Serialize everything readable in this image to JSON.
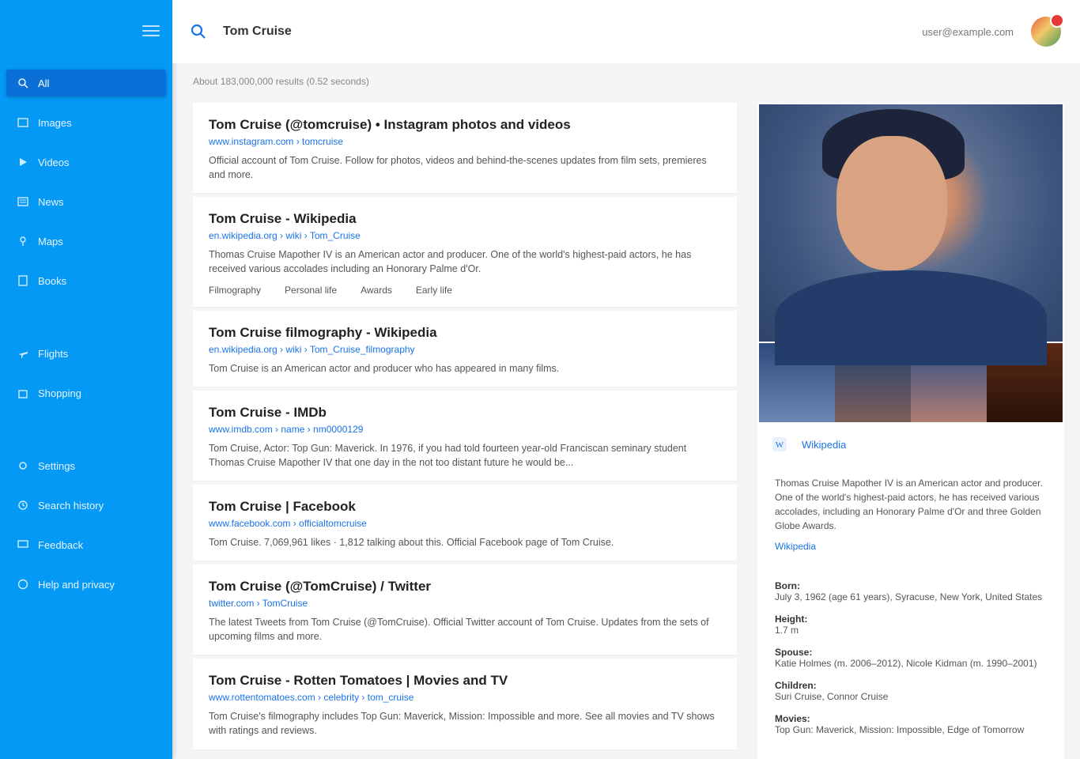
{
  "header": {
    "query": "Tom Cruise",
    "user_email": "user@example.com"
  },
  "sidebar": {
    "items": [
      {
        "label": "All"
      },
      {
        "label": "Images"
      },
      {
        "label": "Videos"
      },
      {
        "label": "News"
      },
      {
        "label": "Maps"
      },
      {
        "label": "Books"
      },
      {
        "label": "Flights"
      },
      {
        "label": "Shopping"
      },
      {
        "label": "Settings"
      },
      {
        "label": "Search history"
      },
      {
        "label": "Feedback"
      },
      {
        "label": "Help and privacy"
      }
    ]
  },
  "results_info": "About 183,000,000 results (0.52 seconds)",
  "results": [
    {
      "title": "Tom Cruise (@tomcruise) • Instagram photos and videos",
      "url": "www.instagram.com › tomcruise",
      "snippet": "Official account of Tom Cruise. Follow for photos, videos and behind-the-scenes updates from film sets, premieres and more."
    },
    {
      "title": "Tom Cruise - Wikipedia",
      "url": "en.wikipedia.org › wiki › Tom_Cruise",
      "snippet": "Thomas Cruise Mapother IV is an American actor and producer. One of the world's highest-paid actors, he has received various accolades including an Honorary Palme d'Or.",
      "links": [
        "Filmography",
        "Personal life",
        "Awards",
        "Early life"
      ]
    },
    {
      "title": "Tom Cruise filmography - Wikipedia",
      "url": "en.wikipedia.org › wiki › Tom_Cruise_filmography",
      "snippet": "Tom Cruise is an American actor and producer who has appeared in many films."
    },
    {
      "title": "Tom Cruise - IMDb",
      "url": "www.imdb.com › name › nm0000129",
      "snippet": "Tom Cruise, Actor: Top Gun: Maverick. In 1976, if you had told fourteen year-old Franciscan seminary student Thomas Cruise Mapother IV that one day in the not too distant future he would be..."
    },
    {
      "title": "Tom Cruise | Facebook",
      "url": "www.facebook.com › officialtomcruise",
      "snippet": "Tom Cruise. 7,069,961 likes · 1,812 talking about this. Official Facebook page of Tom Cruise."
    },
    {
      "title": "Tom Cruise (@TomCruise) / Twitter",
      "url": "twitter.com › TomCruise",
      "snippet": "The latest Tweets from Tom Cruise (@TomCruise). Official Twitter account of Tom Cruise. Updates from the sets of upcoming films and more."
    },
    {
      "title": "Tom Cruise - Rotten Tomatoes | Movies and TV",
      "url": "www.rottentomatoes.com › celebrity › tom_cruise",
      "snippet": "Tom Cruise's filmography includes Top Gun: Maverick, Mission: Impossible and more. See all movies and TV shows with ratings and reviews."
    }
  ],
  "panel": {
    "source_label": "Wikipedia",
    "description": "Thomas Cruise Mapother IV is an American actor and producer. One of the world's highest-paid actors, he has received various accolades, including an Honorary Palme d'Or and three Golden Globe Awards.",
    "more_label": "Wikipedia",
    "facts": [
      {
        "key": "Born:",
        "value": "July 3, 1962 (age 61 years), Syracuse, New York, United States"
      },
      {
        "key": "Height:",
        "value": "1.7 m"
      },
      {
        "key": "Spouse:",
        "value": "Katie Holmes (m. 2006–2012), Nicole Kidman (m. 1990–2001)"
      },
      {
        "key": "Children:",
        "value": "Suri Cruise, Connor Cruise"
      },
      {
        "key": "Movies:",
        "value": "Top Gun: Maverick, Mission: Impossible, Edge of Tomorrow"
      }
    ]
  },
  "colors": {
    "sidebar": "#0399f5",
    "sidebar_active": "#0a6fd6",
    "link": "#1a73e8"
  }
}
